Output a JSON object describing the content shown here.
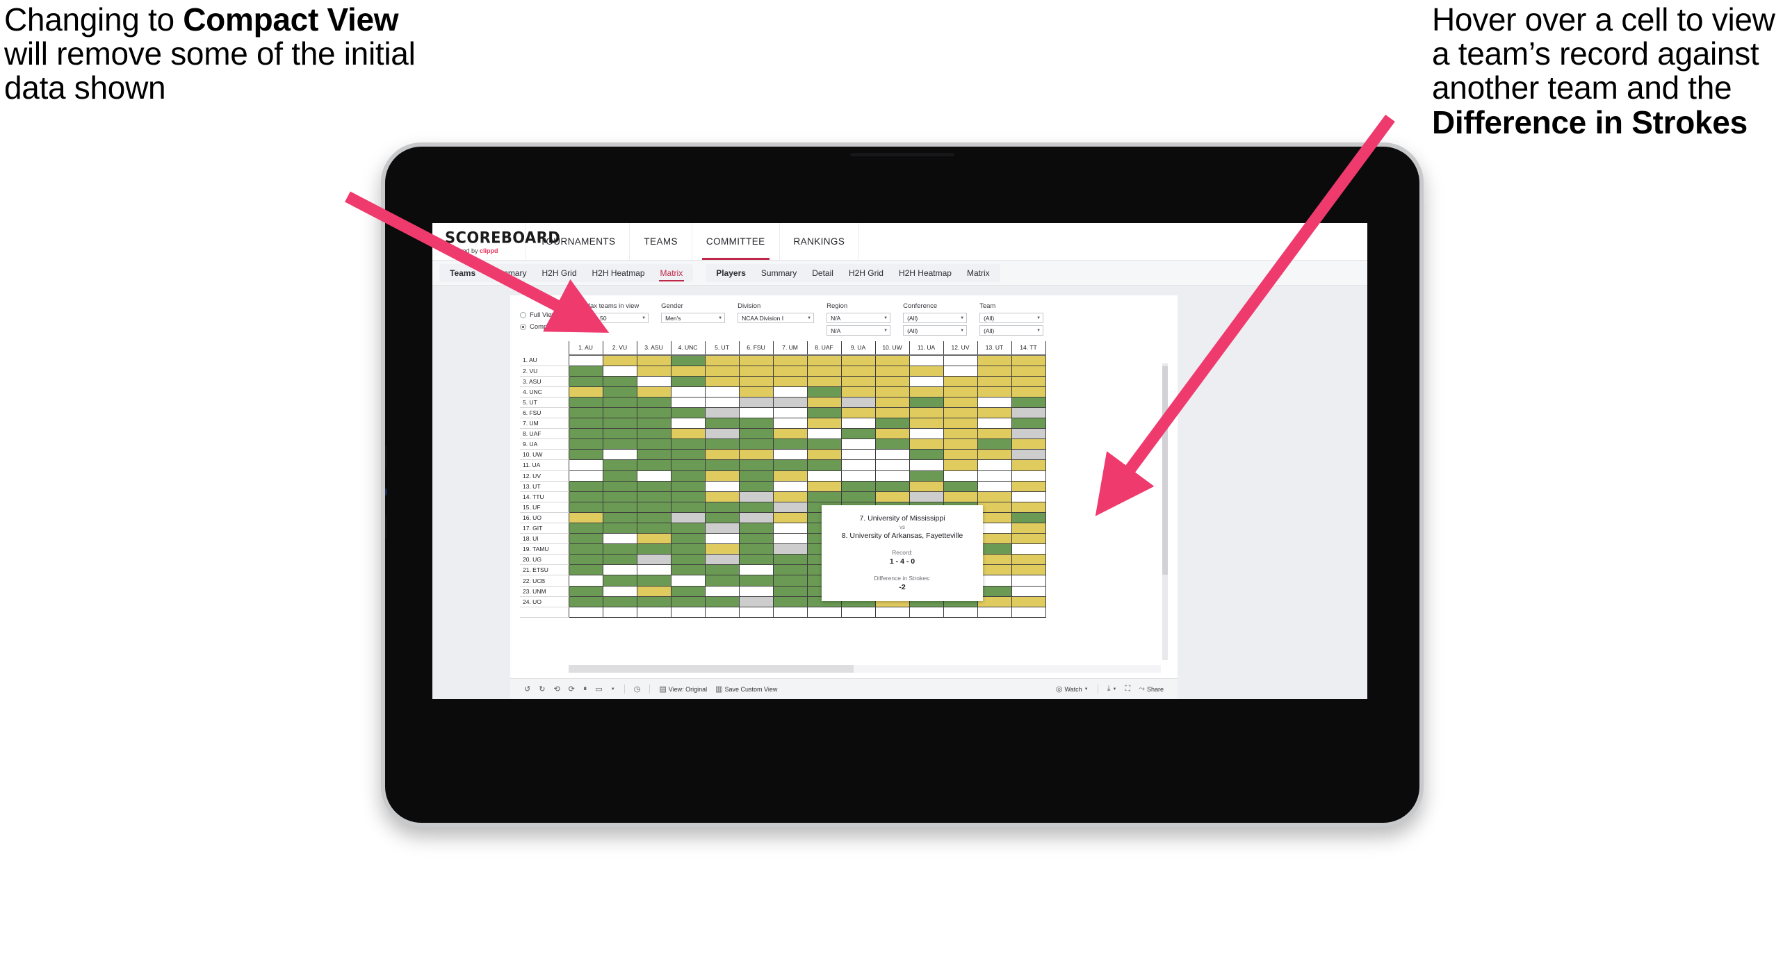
{
  "annotations": {
    "left": {
      "pre": "Changing to ",
      "bold": "Compact View",
      "post": " will remove some of the initial data shown"
    },
    "right": {
      "pre": "Hover over a cell to view a team’s record against another team and the ",
      "bold": "Difference in Strokes",
      "post": ""
    }
  },
  "accent": "#ef3a6e",
  "colors": {
    "green": "#6a9a53",
    "gold": "#e0cb5e",
    "grey": "#cdcdcd",
    "white": "#ffffff",
    "brand_red": "#c0284a"
  },
  "app": {
    "brand": {
      "title": "SCOREBOARD",
      "tagline_pre": "Powered by ",
      "tagline_brand": "clippd"
    },
    "top_nav": [
      {
        "label": "TOURNAMENTS",
        "active": false
      },
      {
        "label": "TEAMS",
        "active": false
      },
      {
        "label": "COMMITTEE",
        "active": true
      },
      {
        "label": "RANKINGS",
        "active": false
      }
    ],
    "sub_nav_teams": [
      {
        "label": "Teams",
        "lead": true,
        "selected": false
      },
      {
        "label": "Summary",
        "lead": false,
        "selected": false
      },
      {
        "label": "H2H Grid",
        "lead": false,
        "selected": false
      },
      {
        "label": "H2H Heatmap",
        "lead": false,
        "selected": false
      },
      {
        "label": "Matrix",
        "lead": false,
        "selected": true
      }
    ],
    "sub_nav_players": [
      {
        "label": "Players",
        "lead": true,
        "selected": false
      },
      {
        "label": "Summary",
        "lead": false,
        "selected": false
      },
      {
        "label": "Detail",
        "lead": false,
        "selected": false
      },
      {
        "label": "H2H Grid",
        "lead": false,
        "selected": false
      },
      {
        "label": "H2H Heatmap",
        "lead": false,
        "selected": false
      },
      {
        "label": "Matrix",
        "lead": false,
        "selected": false
      }
    ]
  },
  "filters": {
    "view_mode": {
      "options": [
        "Full View",
        "Compact View"
      ],
      "selected": "Compact View"
    },
    "max_teams": {
      "label": "Max teams in view",
      "value": "Top 50"
    },
    "gender": {
      "label": "Gender",
      "value": "Men's"
    },
    "division": {
      "label": "Division",
      "value": "NCAA Division I"
    },
    "region": {
      "label": "Region",
      "value1": "N/A",
      "value2": "N/A"
    },
    "conference": {
      "label": "Conference",
      "value1": "(All)",
      "value2": "(All)"
    },
    "team": {
      "label": "Team",
      "value1": "(All)",
      "value2": "(All)"
    }
  },
  "matrix": {
    "columns": [
      "1. AU",
      "2. VU",
      "3. ASU",
      "4. UNC",
      "5. UT",
      "6. FSU",
      "7. UM",
      "8. UAF",
      "9. UA",
      "10. UW",
      "11. UA",
      "12. UV",
      "13. UT",
      "14. TT"
    ],
    "rows": [
      "1. AU",
      "2. VU",
      "3. ASU",
      "4. UNC",
      "5. UT",
      "6. FSU",
      "7. UM",
      "8. UAF",
      "9. UA",
      "10. UW",
      "11. UA",
      "12. UV",
      "13. UT",
      "14. TTU",
      "15. UF",
      "16. UO",
      "17. GIT",
      "18. UI",
      "19. TAMU",
      "20. UG",
      "21. ETSU",
      "22. UCB",
      "23. UNM",
      "24. UO"
    ],
    "legend": {
      "g": "win",
      "y": "loss",
      "k": "tie",
      "w": "no-data"
    },
    "cells": [
      [
        "n",
        "y",
        "y",
        "g",
        "y",
        "y",
        "y",
        "y",
        "y",
        "y",
        "w",
        "w",
        "y",
        "y"
      ],
      [
        "g",
        "n",
        "y",
        "y",
        "y",
        "y",
        "y",
        "y",
        "y",
        "y",
        "y",
        "w",
        "y",
        "y"
      ],
      [
        "g",
        "g",
        "n",
        "g",
        "y",
        "y",
        "y",
        "y",
        "y",
        "y",
        "w",
        "y",
        "y",
        "y"
      ],
      [
        "y",
        "g",
        "y",
        "n",
        "w",
        "y",
        "w",
        "g",
        "y",
        "y",
        "y",
        "y",
        "y",
        "y"
      ],
      [
        "g",
        "g",
        "g",
        "w",
        "n",
        "k",
        "k",
        "y",
        "k",
        "y",
        "g",
        "y",
        "w",
        "g"
      ],
      [
        "g",
        "g",
        "g",
        "g",
        "k",
        "n",
        "w",
        "g",
        "y",
        "y",
        "y",
        "y",
        "y",
        "k"
      ],
      [
        "g",
        "g",
        "g",
        "w",
        "g",
        "g",
        "n",
        "y",
        "w",
        "g",
        "y",
        "y",
        "w",
        "g"
      ],
      [
        "g",
        "g",
        "g",
        "y",
        "k",
        "g",
        "y",
        "n",
        "g",
        "y",
        "w",
        "y",
        "y",
        "k"
      ],
      [
        "g",
        "g",
        "g",
        "g",
        "g",
        "g",
        "g",
        "g",
        "n",
        "g",
        "y",
        "y",
        "g",
        "y"
      ],
      [
        "g",
        "w",
        "g",
        "g",
        "y",
        "y",
        "w",
        "y",
        "w",
        "n",
        "g",
        "y",
        "y",
        "k"
      ],
      [
        "w",
        "g",
        "g",
        "g",
        "g",
        "g",
        "g",
        "g",
        "w",
        "w",
        "n",
        "y",
        "w",
        "y"
      ],
      [
        "w",
        "g",
        "w",
        "g",
        "y",
        "g",
        "y",
        "w",
        "w",
        "w",
        "g",
        "n",
        "w",
        "w"
      ],
      [
        "g",
        "g",
        "g",
        "g",
        "w",
        "g",
        "w",
        "y",
        "g",
        "g",
        "y",
        "g",
        "n",
        "y"
      ],
      [
        "g",
        "g",
        "g",
        "g",
        "y",
        "k",
        "y",
        "g",
        "g",
        "y",
        "k",
        "y",
        "y",
        "n"
      ],
      [
        "g",
        "g",
        "g",
        "g",
        "g",
        "g",
        "k",
        "g",
        "g",
        "g",
        "g",
        "g",
        "y",
        "y"
      ],
      [
        "y",
        "g",
        "g",
        "k",
        "g",
        "k",
        "y",
        "g",
        "y",
        "g",
        "y",
        "y",
        "y",
        "g"
      ],
      [
        "g",
        "g",
        "g",
        "g",
        "k",
        "g",
        "w",
        "g",
        "g",
        "g",
        "y",
        "y",
        "w",
        "y"
      ],
      [
        "g",
        "w",
        "y",
        "g",
        "w",
        "g",
        "w",
        "g",
        "g",
        "g",
        "y",
        "g",
        "y",
        "y"
      ],
      [
        "g",
        "g",
        "g",
        "g",
        "y",
        "g",
        "k",
        "g",
        "g",
        "y",
        "y",
        "y",
        "g",
        "w"
      ],
      [
        "g",
        "g",
        "k",
        "g",
        "k",
        "g",
        "g",
        "g",
        "g",
        "y",
        "y",
        "y",
        "y",
        "y"
      ],
      [
        "g",
        "w",
        "w",
        "g",
        "g",
        "w",
        "g",
        "g",
        "g",
        "y",
        "y",
        "g",
        "y",
        "y"
      ],
      [
        "w",
        "g",
        "g",
        "w",
        "g",
        "g",
        "g",
        "g",
        "g",
        "y",
        "g",
        "y",
        "w",
        "w"
      ],
      [
        "g",
        "w",
        "y",
        "g",
        "w",
        "w",
        "g",
        "g",
        "g",
        "y",
        "g",
        "g",
        "g",
        "w"
      ],
      [
        "g",
        "g",
        "g",
        "g",
        "g",
        "k",
        "g",
        "g",
        "g",
        "y",
        "g",
        "g",
        "y",
        "y"
      ]
    ]
  },
  "tooltip": {
    "team_a": "7. University of Mississippi",
    "vs": "vs",
    "team_b": "8. University of Arkansas, Fayetteville",
    "record_label": "Record:",
    "record_value": "1 - 4 - 0",
    "diff_label": "Difference in Strokes:",
    "diff_value": "-2"
  },
  "toolbar": {
    "icons": [
      "undo-icon",
      "redo-icon",
      "revert-icon",
      "refresh-icon",
      "pause-icon",
      "shape-icon",
      "caret-icon",
      "history-icon"
    ],
    "view_original": "View: Original",
    "save_custom_view": "Save Custom View",
    "watch": "Watch",
    "share": "Share"
  }
}
